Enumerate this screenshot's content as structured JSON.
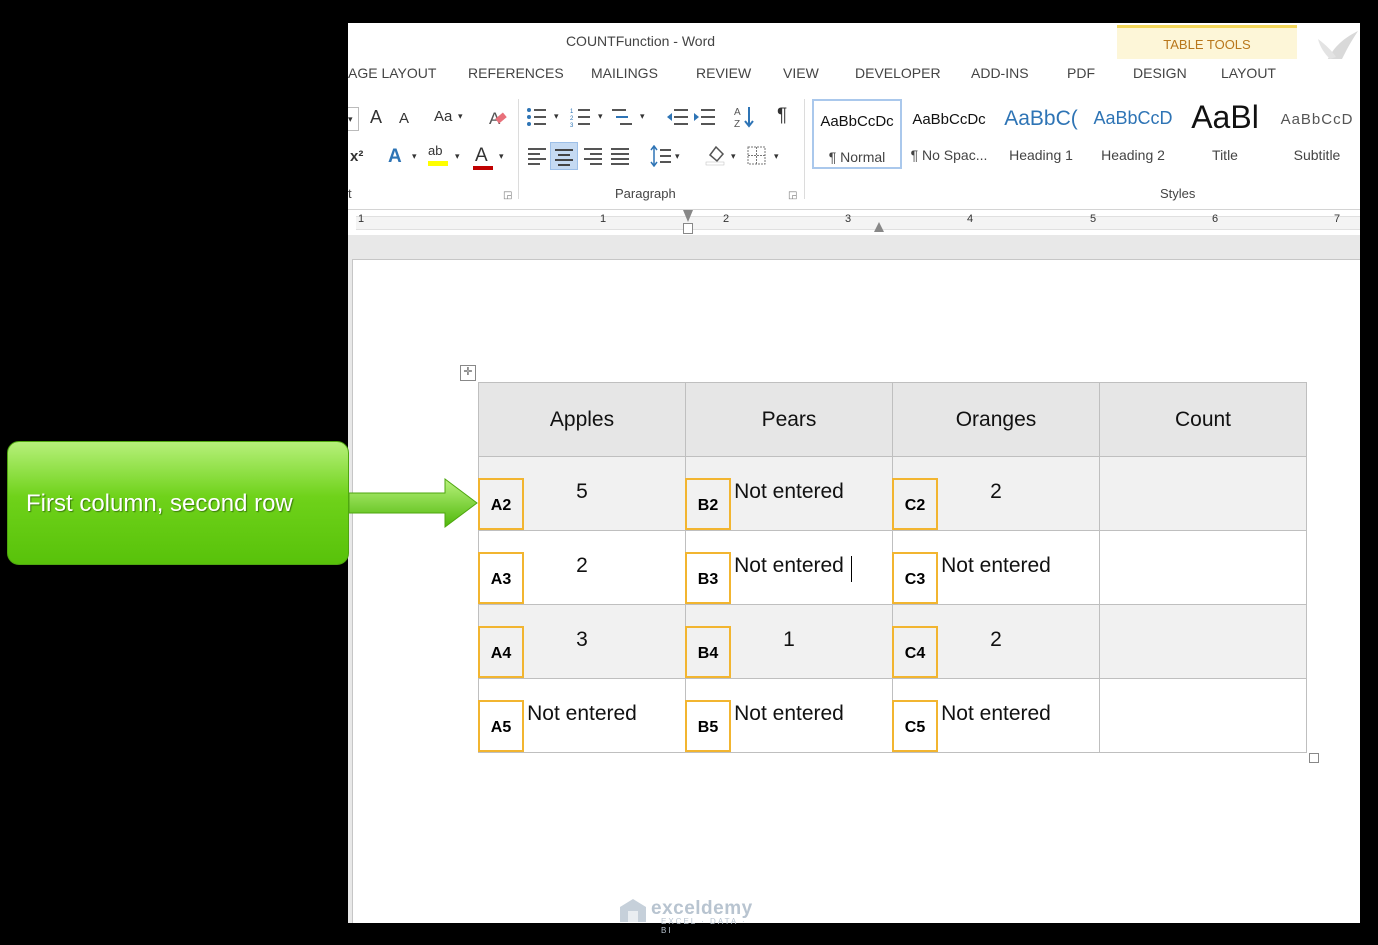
{
  "window": {
    "title": "COUNTFunction - Word"
  },
  "tabs": [
    "AGE LAYOUT",
    "REFERENCES",
    "MAILINGS",
    "REVIEW",
    "VIEW",
    "DEVELOPER",
    "ADD-INS",
    "PDF"
  ],
  "table_tools": {
    "label": "TABLE TOOLS",
    "tabs": [
      "DESIGN",
      "LAYOUT"
    ]
  },
  "ribbon": {
    "font_group_label": "t",
    "paragraph_group_label": "Paragraph",
    "styles_group_label": "Styles",
    "font_buttons": {
      "grow": "A",
      "shrink": "A",
      "change_case": "Aa",
      "superscript": "x²",
      "text_effects": "A",
      "highlight": "ab",
      "font_color": "A"
    },
    "styles": [
      {
        "sample": "AaBbCcDc",
        "name": "¶ Normal"
      },
      {
        "sample": "AaBbCcDc",
        "name": "¶ No Spac..."
      },
      {
        "sample": "AaBbC(",
        "name": "Heading 1"
      },
      {
        "sample": "AaBbCcD",
        "name": "Heading 2"
      },
      {
        "sample": "AaBl",
        "name": "Title"
      },
      {
        "sample": "AaBbCcD",
        "name": "Subtitle"
      }
    ],
    "colors": {
      "heading1": "#2e74b5",
      "heading2": "#2e74b5",
      "highlight": "#ffff00",
      "font_color": "#c00000"
    }
  },
  "ruler": {
    "numbers": [
      "1",
      "1",
      "2",
      "3",
      "4",
      "5",
      "6",
      "7"
    ]
  },
  "table": {
    "headers": [
      "Apples",
      "Pears",
      "Oranges",
      "Count"
    ],
    "rows": [
      {
        "cells": [
          {
            "ref": "A2",
            "value": "5"
          },
          {
            "ref": "B2",
            "value": "Not entered"
          },
          {
            "ref": "C2",
            "value": "2"
          },
          {
            "ref": "",
            "value": ""
          }
        ]
      },
      {
        "cells": [
          {
            "ref": "A3",
            "value": "2"
          },
          {
            "ref": "B3",
            "value": "Not entered"
          },
          {
            "ref": "C3",
            "value": "Not entered"
          },
          {
            "ref": "",
            "value": ""
          }
        ]
      },
      {
        "cells": [
          {
            "ref": "A4",
            "value": "3"
          },
          {
            "ref": "B4",
            "value": "1"
          },
          {
            "ref": "C4",
            "value": "2"
          },
          {
            "ref": "",
            "value": ""
          }
        ]
      },
      {
        "cells": [
          {
            "ref": "A5",
            "value": "Not entered"
          },
          {
            "ref": "B5",
            "value": "Not entered"
          },
          {
            "ref": "C5",
            "value": "Not entered"
          },
          {
            "ref": "",
            "value": ""
          }
        ]
      }
    ],
    "ref_box_color": "#f2b530"
  },
  "callout": {
    "text": "First column, second row",
    "color": "#6fd21a"
  },
  "watermark": {
    "text": "exceldemy",
    "sub": "EXCEL · DATA · BI"
  }
}
